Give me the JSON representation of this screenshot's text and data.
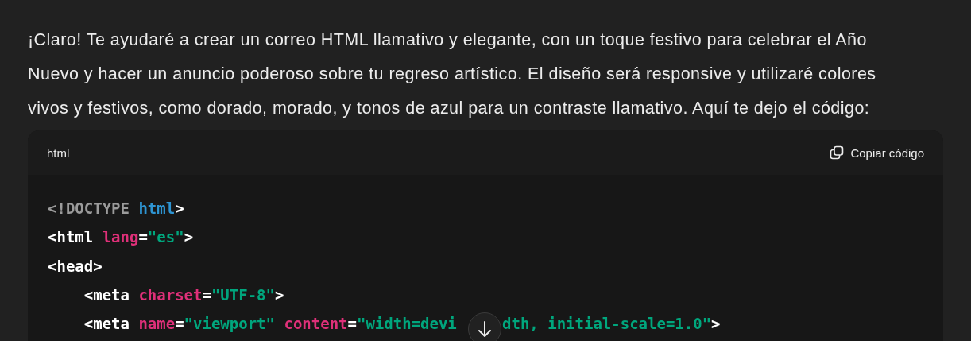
{
  "message": {
    "text": "¡Claro! Te ayudaré a crear un correo HTML llamativo y elegante, con un toque festivo para celebrar el Año Nuevo y hacer un anuncio poderoso sobre tu regreso artístico. El diseño será responsive y utilizaré colores vivos y festivos, como dorado, morado, y tonos de azul para un contraste llamativo. Aquí te dejo el código:"
  },
  "code_block": {
    "language": "html",
    "copy_label": "Copiar código",
    "lines": [
      {
        "indented": false,
        "tokens": [
          {
            "kind": "doctype",
            "text": "<!DOCTYPE"
          },
          {
            "kind": "keyword",
            "text": " html"
          },
          {
            "kind": "tag",
            "text": ">"
          }
        ]
      },
      {
        "indented": false,
        "tokens": [
          {
            "kind": "tag",
            "text": "<html"
          },
          {
            "kind": "attr",
            "text": " lang"
          },
          {
            "kind": "tag",
            "text": "="
          },
          {
            "kind": "string",
            "text": "\"es\""
          },
          {
            "kind": "tag",
            "text": ">"
          }
        ]
      },
      {
        "indented": false,
        "tokens": [
          {
            "kind": "tag",
            "text": "<head>"
          }
        ]
      },
      {
        "indented": true,
        "tokens": [
          {
            "kind": "tag",
            "text": "<meta"
          },
          {
            "kind": "attr",
            "text": " charset"
          },
          {
            "kind": "tag",
            "text": "="
          },
          {
            "kind": "string",
            "text": "\"UTF-8\""
          },
          {
            "kind": "tag",
            "text": ">"
          }
        ]
      },
      {
        "indented": true,
        "tokens": [
          {
            "kind": "tag",
            "text": "<meta"
          },
          {
            "kind": "attr",
            "text": " name"
          },
          {
            "kind": "tag",
            "text": "="
          },
          {
            "kind": "string",
            "text": "\"viewport\""
          },
          {
            "kind": "attr",
            "text": " content"
          },
          {
            "kind": "tag",
            "text": "="
          },
          {
            "kind": "string",
            "text": "\"width=devi"
          },
          {
            "kind": "covered"
          },
          {
            "kind": "string",
            "text": "dth, initial-scale=1.0\""
          },
          {
            "kind": "tag",
            "text": ">"
          }
        ]
      }
    ]
  },
  "scroll_button": {
    "kind": "scroll-down"
  }
}
